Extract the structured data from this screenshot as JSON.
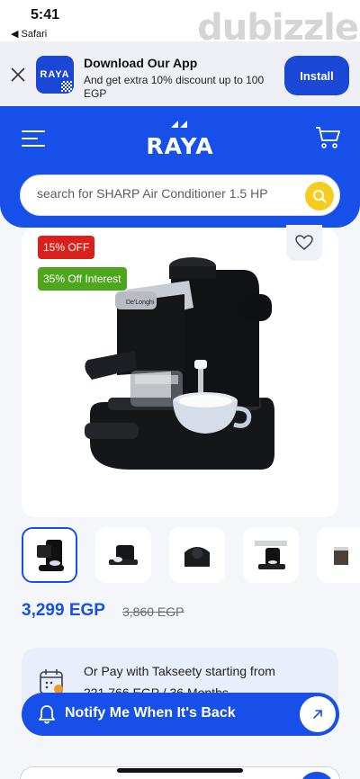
{
  "status_bar": {
    "time": "5:41",
    "back_label": "◀ Safari",
    "watermark": "dubizzle"
  },
  "app_banner": {
    "title": "Download Our App",
    "subtitle": "And get extra 10% discount up to 100 EGP",
    "install_label": "Install",
    "logo_text": "RAYA"
  },
  "header": {
    "brand": "RAYA",
    "search_placeholder": "search for SHARP Air Conditioner 1.5 HP",
    "accent_color": "#1650e8"
  },
  "product": {
    "badges": [
      "15% OFF",
      "35% Off Interest"
    ],
    "thumbnail_count": 5,
    "selected_thumbnail": 1,
    "price": "3,299 EGP",
    "old_price": "3,860 EGP"
  },
  "installment": {
    "line1": "Or Pay with Takseety starting from",
    "line2": "221.766 EGP / 36 Months"
  },
  "notify": {
    "label": "Notify Me When It's Back"
  },
  "icons": [
    "close-icon",
    "hamburger-menu-icon",
    "cart-icon",
    "search-icon",
    "heart-icon",
    "calendar-icon",
    "bell-icon",
    "arrow-up-right-icon"
  ]
}
